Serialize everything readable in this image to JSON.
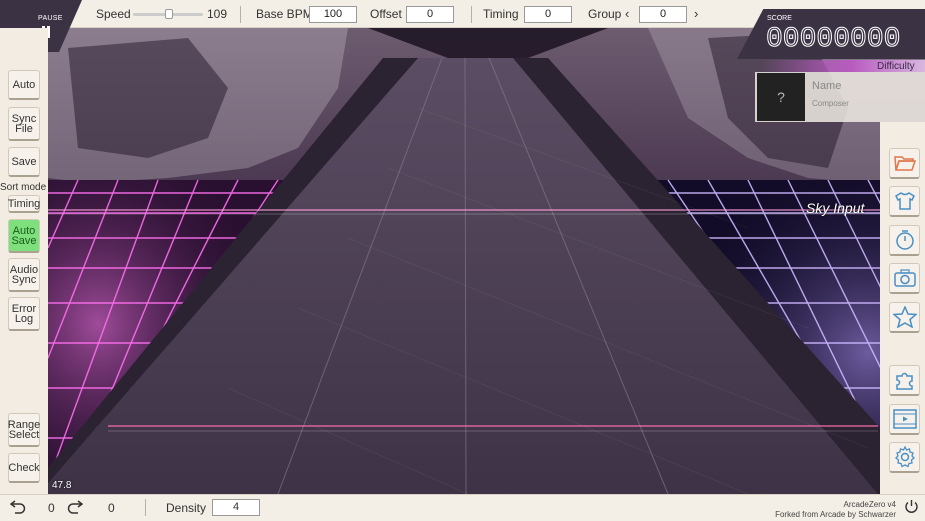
{
  "topbar": {
    "pause_label": "PAUSE",
    "speed_label": "Speed",
    "speed_value": "109",
    "base_bpm_label": "Base BPM",
    "base_bpm_value": "100",
    "offset_label": "Offset",
    "offset_value": "0",
    "timing_label": "Timing",
    "timing_value": "0",
    "group_label": "Group",
    "group_value": "0",
    "prev_icon": "chevron-left-icon",
    "next_icon": "chevron-right-icon"
  },
  "score": {
    "label": "SCORE",
    "value": "00000000",
    "difficulty": "Difficulty",
    "song_name": "Name",
    "composer": "Composer",
    "cover_placeholder": "?"
  },
  "left_toolbar": {
    "auto": "Auto",
    "sync_file": [
      "Sync",
      "File"
    ],
    "save": "Save",
    "sort_mode_label": "Sort mode",
    "timing": "Timing",
    "auto_save": [
      "Auto",
      "Save"
    ],
    "audio_sync": [
      "Audio",
      "Sync"
    ],
    "error_log": [
      "Error",
      "Log"
    ],
    "range_select": [
      "Range",
      "Select"
    ],
    "check": "Check",
    "active_color": "#7de07c"
  },
  "right_toolbar": {
    "icons": [
      "folder-icon",
      "shirt-icon",
      "timer-icon",
      "camera-icon",
      "star-icon",
      "puzzle-icon",
      "video-icon",
      "gear-icon"
    ],
    "icon_color": "#4a8fc4"
  },
  "scene": {
    "sky_input": "Sky Input",
    "fps": "47.8"
  },
  "bottombar": {
    "undo_icon": "undo-icon",
    "undo_count": "0",
    "redo_icon": "redo-icon",
    "redo_count": "0",
    "density_label": "Density",
    "density_value": "4",
    "version": "ArcadeZero v4",
    "forked_from": "Forked from Arcade by Schwarzer",
    "power_icon": "power-icon"
  }
}
